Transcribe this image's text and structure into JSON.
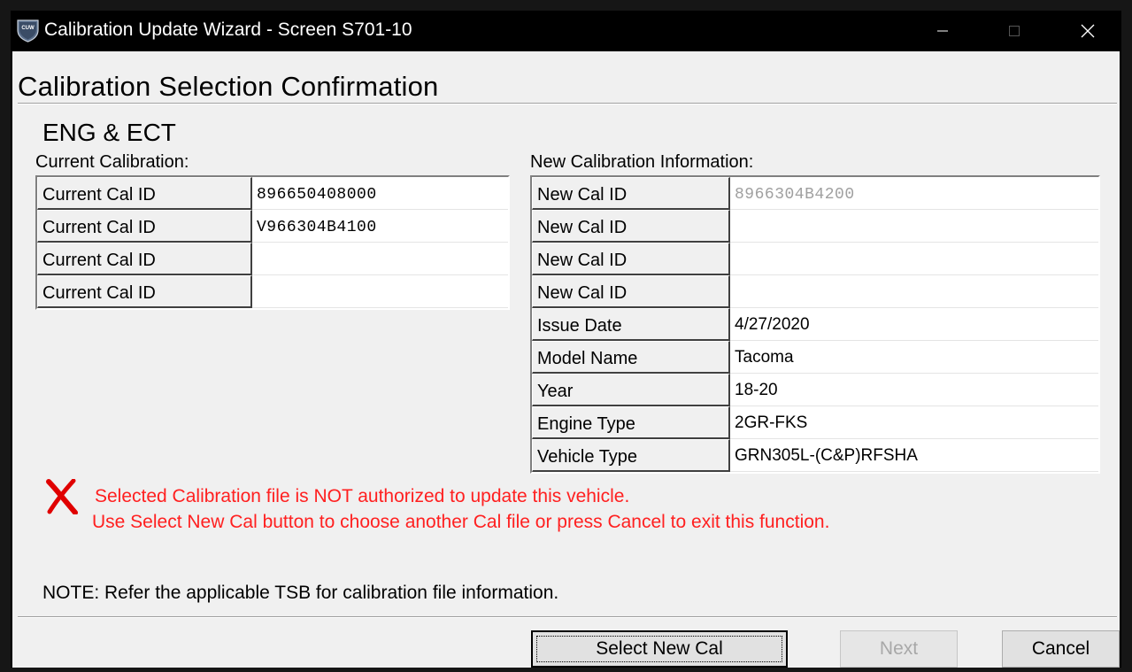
{
  "window": {
    "title": "Calibration Update Wizard - Screen S701-10",
    "app_icon": "cuw-shield-icon",
    "app_icon_text": "CUW",
    "controls": {
      "minimize": "minimize-icon",
      "maximize": "maximize-icon",
      "close": "close-icon"
    }
  },
  "page": {
    "title": "Calibration Selection Confirmation",
    "section": "ENG & ECT"
  },
  "current": {
    "label": "Current Calibration:",
    "rows": [
      {
        "label": "Current Cal ID",
        "value": "896650408000"
      },
      {
        "label": "Current Cal ID",
        "value": "V966304B4100"
      },
      {
        "label": "Current Cal ID",
        "value": ""
      },
      {
        "label": "Current Cal ID",
        "value": ""
      }
    ]
  },
  "new_info": {
    "label": "New Calibration Information:",
    "rows": [
      {
        "label": "New Cal ID",
        "value": "8966304B4200"
      },
      {
        "label": "New Cal ID",
        "value": ""
      },
      {
        "label": "New Cal ID",
        "value": ""
      },
      {
        "label": "New Cal ID",
        "value": ""
      },
      {
        "label": "Issue Date",
        "value": "4/27/2020"
      },
      {
        "label": "Model Name",
        "value": "Tacoma"
      },
      {
        "label": "Year",
        "value": "18-20"
      },
      {
        "label": "Engine Type",
        "value": "2GR-FKS"
      },
      {
        "label": "Vehicle Type",
        "value": "GRN305L-(C&P)RFSHA"
      }
    ]
  },
  "error": {
    "icon": "red-x-error-icon",
    "color": "#ff2020",
    "line1": "Selected Calibration file is NOT authorized to update this vehicle.",
    "line2": "Use Select New Cal button to choose another Cal file or press Cancel to exit this function."
  },
  "note": "NOTE: Refer the applicable TSB for calibration file information.",
  "buttons": {
    "select_new_cal": "Select New Cal",
    "next": "Next",
    "cancel": "Cancel"
  }
}
